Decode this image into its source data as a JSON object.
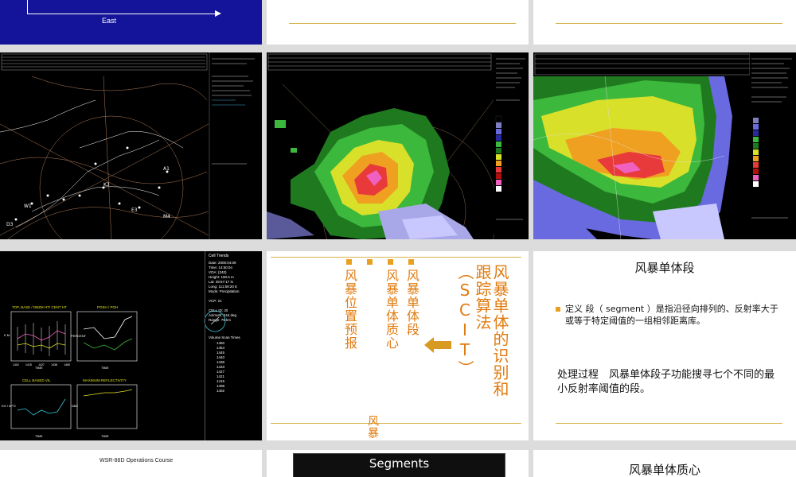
{
  "row1": {
    "east_label": "East"
  },
  "cell_trends": {
    "title": "Cell Trends",
    "info": [
      "Date: 2006:04:09",
      "Time: 14:50:04",
      "VOA: (240)",
      "Height: 190.5 m",
      "Lat: 39:57:17 N",
      "Long: 111:59:20 E",
      "Mode: Precipitation",
      "",
      "VCP: 21",
      "",
      "CELL ID: J0",
      "Azimuth: 244 deg",
      "Range: 75 km"
    ],
    "scan_title": "Volume Scan Times",
    "scan_times": [
      "1450",
      "1454",
      "1445",
      "1440",
      "1438",
      "1433",
      "1427",
      "1421",
      "1415",
      "1408",
      "1402"
    ],
    "chart1_title": "TOP, BASE / DBZM HT/ CENT HT",
    "chart2_title": "POSH / POH",
    "chart3_title": "CELL BASED VIL",
    "chart4_title": "MAXIMUM REFLECTIVITY",
    "ylabel1": "K M",
    "ylabel2": "PERCENT",
    "ylabel3": "KG / M**2",
    "ylabel4": "DBZ",
    "xlabel": "TIME",
    "xticks": [
      "1402",
      "1415",
      "1427",
      "1438",
      "1450"
    ]
  },
  "scit": {
    "title": "风暴单体的识别和跟踪算法（SCIT）",
    "items": [
      "风暴单体段",
      "风暴单体质心",
      "风暴位置预报"
    ],
    "bottom_fragment": "风暴"
  },
  "segment_slide": {
    "title": "风暴单体段",
    "bullet": "定义 段（ segment ）是指沿径向排列的、反射率大于或等于特定阈值的一组相邻距离库。",
    "process": "处理过程　风暴单体段子功能搜寻七个不同的最小反射率阈值的段。"
  },
  "row4": {
    "course": "WSR-88D Operations Course",
    "segments": "Segments",
    "centroid_title": "风暴单体质心"
  },
  "colors": {
    "accent": "#d8b24a",
    "orange_text": "#e07b10",
    "deep_blue": "#14149a"
  }
}
